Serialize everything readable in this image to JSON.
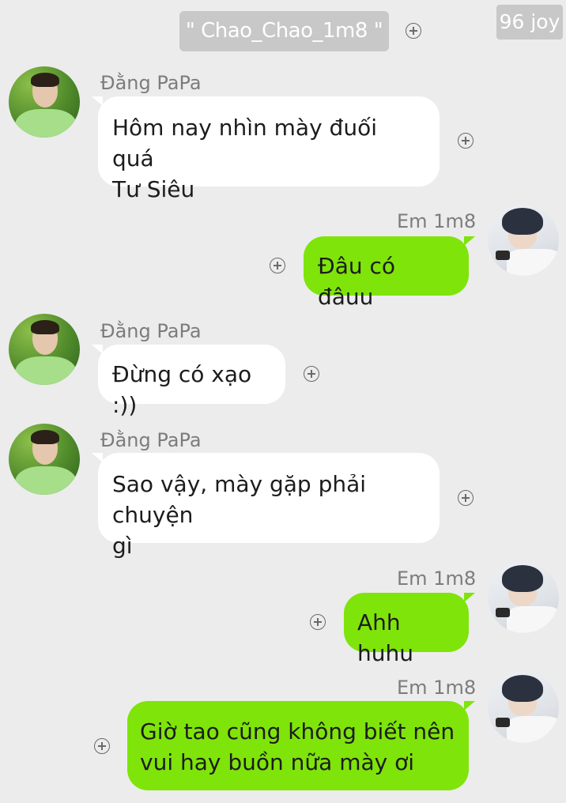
{
  "header": {
    "title": "\" Chao_Chao_1m8 \""
  },
  "watermark": "96 joy",
  "messages": [
    {
      "sender": "Đằng PaPa",
      "text_lines": [
        "Hôm nay nhìn mày đuối quá",
        "Tư Siêu"
      ],
      "side": "left"
    },
    {
      "sender": "Em 1m8",
      "text_lines": [
        "Đâu có đâuu"
      ],
      "side": "right"
    },
    {
      "sender": "Đằng PaPa",
      "text_lines": [
        "Đừng có xạo :))"
      ],
      "side": "left"
    },
    {
      "sender": "Đằng PaPa",
      "text_lines": [
        "Sao vậy, mày gặp phải chuyện",
        "gì"
      ],
      "side": "left"
    },
    {
      "sender": "Em 1m8",
      "text_lines": [
        "Ahh huhu"
      ],
      "side": "right"
    },
    {
      "sender": "Em 1m8",
      "text_lines": [
        "Giờ tao cũng không biết nên",
        "vui hay buồn nữa mày ơi"
      ],
      "side": "right"
    }
  ],
  "colors": {
    "background": "#ececec",
    "incoming_bubble": "#ffffff",
    "outgoing_bubble": "#7fe40a",
    "header_pill": "#c8c8c8",
    "sender_name": "#7c7c7c"
  },
  "icons": {
    "add_reaction": "plus-circle-icon",
    "avatar_papa": "avatar-dang-papa",
    "avatar_em": "avatar-em-1m8"
  }
}
